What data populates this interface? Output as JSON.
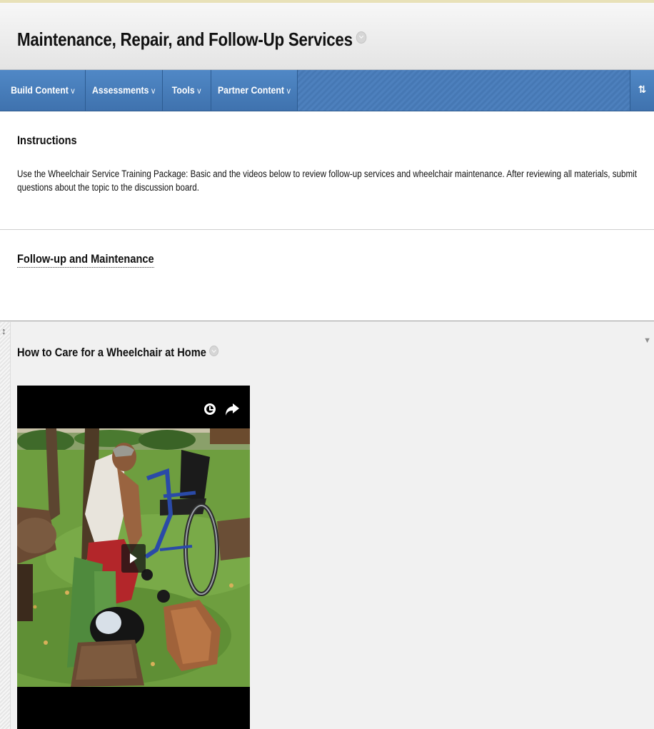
{
  "page": {
    "title": "Maintenance, Repair, and Follow-Up Services"
  },
  "toolbar": {
    "buttons": [
      {
        "label": "Build Content"
      },
      {
        "label": "Assessments"
      },
      {
        "label": "Tools"
      },
      {
        "label": "Partner Content"
      }
    ],
    "caret": "v",
    "sort_icon": "sort-icon",
    "sort_glyph": "⇅"
  },
  "instructions": {
    "heading": "Instructions",
    "text": "Use the Wheelchair Service Training Package: Basic and the videos below to review follow-up services and wheelchair maintenance. After reviewing all materials, submit questions about the topic to the discussion board."
  },
  "follow_up": {
    "link": "Follow-up and Maintenance"
  },
  "content_item": {
    "title": "How to Care for a Wheelchair at Home",
    "drag_glyph": "↕",
    "menu_glyph": "▼",
    "video": {
      "icons": [
        "clock-icon",
        "share-icon",
        "play-icon"
      ]
    }
  },
  "colors": {
    "toolbar_blue": "#4678b4",
    "header_bg": "#ececec",
    "item_bg": "#f1f1f1"
  }
}
